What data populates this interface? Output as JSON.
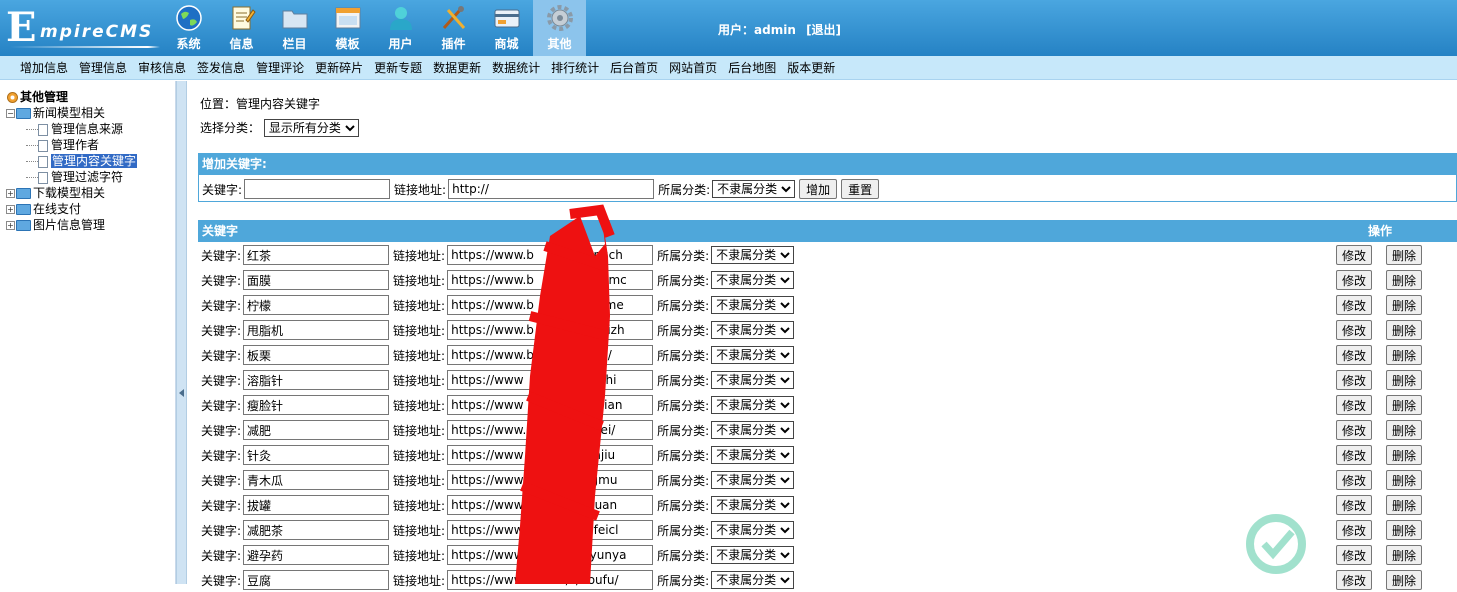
{
  "brand": {
    "logo_big": "E",
    "logo_rest": "mpireCMS"
  },
  "top_nav": [
    {
      "label": "系统",
      "icon": "globe-icon"
    },
    {
      "label": "信息",
      "icon": "notepad-icon"
    },
    {
      "label": "栏目",
      "icon": "folder-icon"
    },
    {
      "label": "模板",
      "icon": "window-icon"
    },
    {
      "label": "用户",
      "icon": "user-icon"
    },
    {
      "label": "插件",
      "icon": "tools-icon"
    },
    {
      "label": "商城",
      "icon": "card-icon"
    },
    {
      "label": "其他",
      "icon": "gear-icon",
      "active": true
    }
  ],
  "user": {
    "prefix": "用户：",
    "name": "admin",
    "logout": "[退出]"
  },
  "sub_nav": [
    "增加信息",
    "管理信息",
    "审核信息",
    "签发信息",
    "管理评论",
    "更新碎片",
    "更新专题",
    "数据更新",
    "数据统计",
    "排行统计",
    "后台首页",
    "网站首页",
    "后台地图",
    "版本更新"
  ],
  "tree": {
    "root": "其他管理",
    "news_group": "新闻模型相关",
    "news_items": [
      "管理信息来源",
      "管理作者",
      "管理内容关键字",
      "管理过滤字符"
    ],
    "selected": "管理内容关键字",
    "other_groups": [
      "下载模型相关",
      "在线支付",
      "图片信息管理"
    ]
  },
  "location": {
    "label": "位置：",
    "value": "管理内容关键字"
  },
  "category_filter": {
    "label": "选择分类：",
    "selected": "显示所有分类"
  },
  "add_section": {
    "title": "增加关键字:",
    "keyword_label": "关键字:",
    "keyword_value": "",
    "url_label": "链接地址:",
    "url_value": "http://",
    "cat_label": "所属分类:",
    "cat_selected": "不隶属分类",
    "add_button": "增加",
    "reset_button": "重置"
  },
  "list_section": {
    "col_keyword": "关键字",
    "col_ops": "操作",
    "row_keyword_label": "关键字:",
    "row_url_label": "链接地址:",
    "row_cat_label": "所属分类:",
    "row_cat_selected": "不隶属分类",
    "edit_button": "修改",
    "delete_button": "删除",
    "rows": [
      {
        "keyword": "红茶",
        "url": "https://www.b         s/hongch"
      },
      {
        "keyword": "面膜",
        "url": "https://www.b         s/mianmc"
      },
      {
        "keyword": "柠檬",
        "url": "https://www.b         s/ningme"
      },
      {
        "keyword": "甩脂机",
        "url": "https://www.b         s/shuaizh"
      },
      {
        "keyword": "板栗",
        "url": "https://www.b         s/banli/"
      },
      {
        "keyword": "溶脂针",
        "url": "https://www          s/rongzhi"
      },
      {
        "keyword": "瘦脸针",
        "url": "https://www          s/shoulian"
      },
      {
        "keyword": "减肥",
        "url": "https://www.          s/jianfei/"
      },
      {
        "keyword": "针灸",
        "url": "https://www          s/zhenjiu"
      },
      {
        "keyword": "青木瓜",
        "url": "https://www          s/qingmu"
      },
      {
        "keyword": "拔罐",
        "url": "https://www          s/baguan"
      },
      {
        "keyword": "减肥茶",
        "url": "https://www          s/jianfeicl"
      },
      {
        "keyword": "避孕药",
        "url": "https://www.        n/s/biyunya"
      },
      {
        "keyword": "豆腐",
        "url": "https://www        m/s/doufu/"
      }
    ]
  }
}
